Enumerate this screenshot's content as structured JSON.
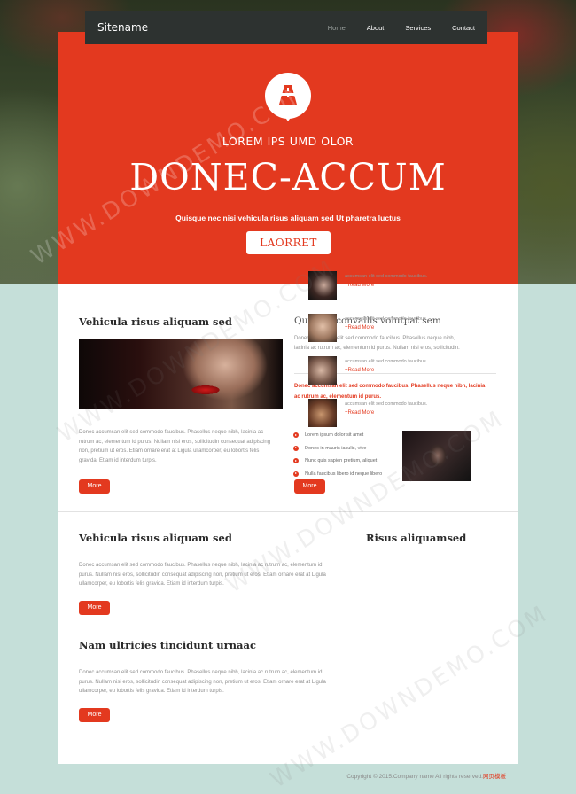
{
  "nav": {
    "site_name": "Sitename",
    "links": [
      "Home",
      "About",
      "Services",
      "Contact"
    ]
  },
  "hero": {
    "subtitle": "LOREM IPS UMD OLOR",
    "title": "DONEC-ACCUM",
    "tagline": "Quisque nec nisi vehicula risus aliquam sed Ut pharetra luctus",
    "button": "LAORRET"
  },
  "section1": {
    "left": {
      "heading": "Vehicula risus aliquam sed",
      "text": "Donec accumsan elit sed commodo faucibus. Phasellus neque nibh, lacinia ac rutrum ac, elementum id purus. Nullam nisi eros, sollicitudin consequat adipiscing non, pretium ut eros. Etiam ornare erat at Ligula ullamcorper, eu lobortis felis gravida. Etiam id interdum turpis.",
      "button": "More"
    },
    "right": {
      "heading": "Quisque convallis volutpat sem",
      "text": "Donec accumsan elit sed commodo faucibus. Phasellus neque nibh, lacinia ac rutrum ac, elementum id purus. Nullam nisi eros, sollicitudin.",
      "highlight": "Donec accumsan elit sed commodo faucibus. Phasellus neque nibh, lacinia ac rutrum ac, elementum id purus.",
      "bullets": [
        "Lorem ipsum dolor sit amet",
        "Donec in mauris iaculis, vive",
        "Nunc quis sapien pretium, aliquet",
        "Nulla faucibus libero id neque libero"
      ],
      "button": "More"
    }
  },
  "section2": {
    "article1": {
      "heading": "Vehicula risus aliquam sed",
      "text": "Donec accumsan elit sed commodo faucibus. Phasellus neque nibh, lacinia ac rutrum ac, elementum id purus. Nullam nisi eros, sollicitudin consequat adipiscing non, pretium ut eros. Etiam ornare erat at Ligula ullamcorper, eu lobortis felis gravida. Etiam id interdum turpis.",
      "button": "More"
    },
    "article2": {
      "heading": "Nam ultricies tincidunt urnaac",
      "text": "Donec accumsan elit sed commodo faucibus. Phasellus neque nibh, lacinia ac rutrum ac, elementum id purus. Nullam nisi eros, sollicitudin consequat adipiscing non, pretium ut eros. Etiam ornare erat at Ligula ullamcorper, eu lobortis felis gravida. Etiam id interdum turpis.",
      "button": "More"
    },
    "sidebar": {
      "heading": "Risus aliquamsed",
      "items": [
        {
          "text": "accumsan elit sed commodo faucibus.",
          "link": "+Read More"
        },
        {
          "text": "accumsan elit sed commodo faucibus.",
          "link": "+Read More"
        },
        {
          "text": "accumsan elit sed commodo faucibus.",
          "link": "+Read More"
        },
        {
          "text": "accumsan elit sed commodo faucibus.",
          "link": "+Read More"
        }
      ]
    }
  },
  "footer": {
    "copyright": "Copyright © 2015.Company name All rights reserved.",
    "link": "网页模板"
  },
  "watermark": "WWW.DOWNDEMO.COM",
  "colors": {
    "accent": "#e3391f",
    "nav_bg": "#2d3230",
    "page_bg": "#c5dfd9"
  },
  "icons": {
    "hero_badge": "road-icon",
    "bullet": "arrow-circle-icon"
  }
}
